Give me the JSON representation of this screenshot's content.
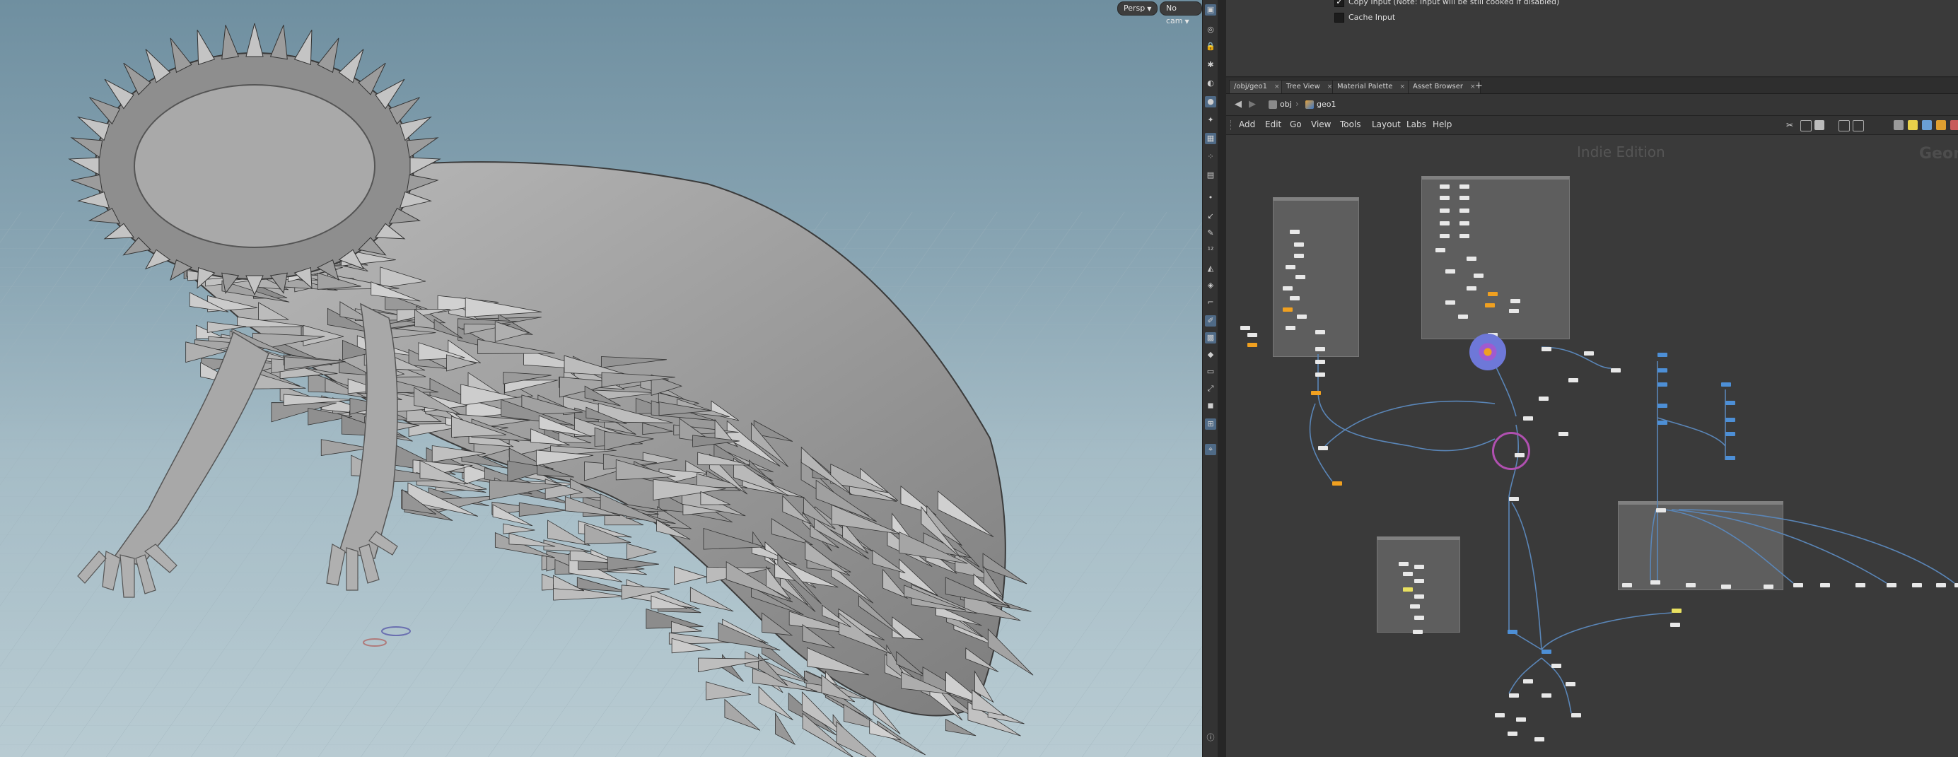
{
  "viewport": {
    "persp_label": "Persp",
    "cam_label": "No cam"
  },
  "params": {
    "copy_input_label": "Copy Input (Note: Input will be still cooked if disabled)",
    "copy_input_checked": true,
    "cache_input_label": "Cache Input",
    "cache_input_checked": false
  },
  "tabs": [
    {
      "label": "/obj/geo1"
    },
    {
      "label": "Tree View"
    },
    {
      "label": "Material Palette"
    },
    {
      "label": "Asset Browser"
    }
  ],
  "tab_add": "+",
  "path": {
    "root": "obj",
    "current": "geo1"
  },
  "menu": [
    "Add",
    "Edit",
    "Go",
    "View",
    "Tools",
    "Layout",
    "Labs",
    "Help"
  ],
  "network": {
    "edition_watermark": "Indie Edition",
    "context_watermark": "Geon"
  },
  "colors": {
    "viewport_sky": "#7f9caa",
    "node_orange": "#f0a020",
    "node_blue": "#4d8fd6",
    "wire_blue": "#5a86b8",
    "selection_purple": "#7b5fc9"
  }
}
